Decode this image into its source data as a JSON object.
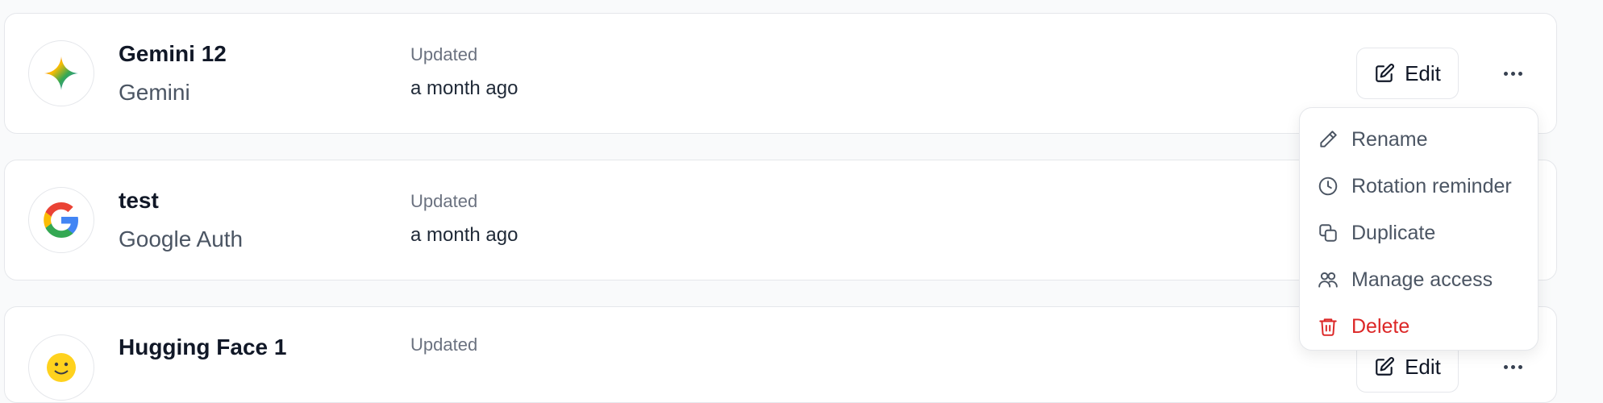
{
  "list": {
    "updated_label": "Updated",
    "edit_label": "Edit",
    "items": [
      {
        "name": "Gemini 12",
        "provider": "Gemini",
        "updated": "a month ago",
        "logo_icon": "gemini-sparkle-icon"
      },
      {
        "name": "test",
        "provider": "Google Auth",
        "updated": "a month ago",
        "logo_icon": "google-g-icon"
      },
      {
        "name": "Hugging Face 1",
        "provider": "",
        "updated": "",
        "logo_icon": "hugging-face-emoji-icon"
      }
    ]
  },
  "menu": {
    "items": [
      {
        "label": "Rename",
        "icon": "pencil-icon"
      },
      {
        "label": "Rotation reminder",
        "icon": "clock-icon"
      },
      {
        "label": "Duplicate",
        "icon": "copy-icon"
      },
      {
        "label": "Manage access",
        "icon": "users-icon"
      },
      {
        "label": "Delete",
        "icon": "trash-icon",
        "color": "#dc2626"
      }
    ]
  },
  "colors": {
    "danger": "#dc2626",
    "text_primary": "#111827",
    "text_secondary": "#4b5563",
    "border": "#e5e7eb",
    "background": "#f9fafb"
  }
}
